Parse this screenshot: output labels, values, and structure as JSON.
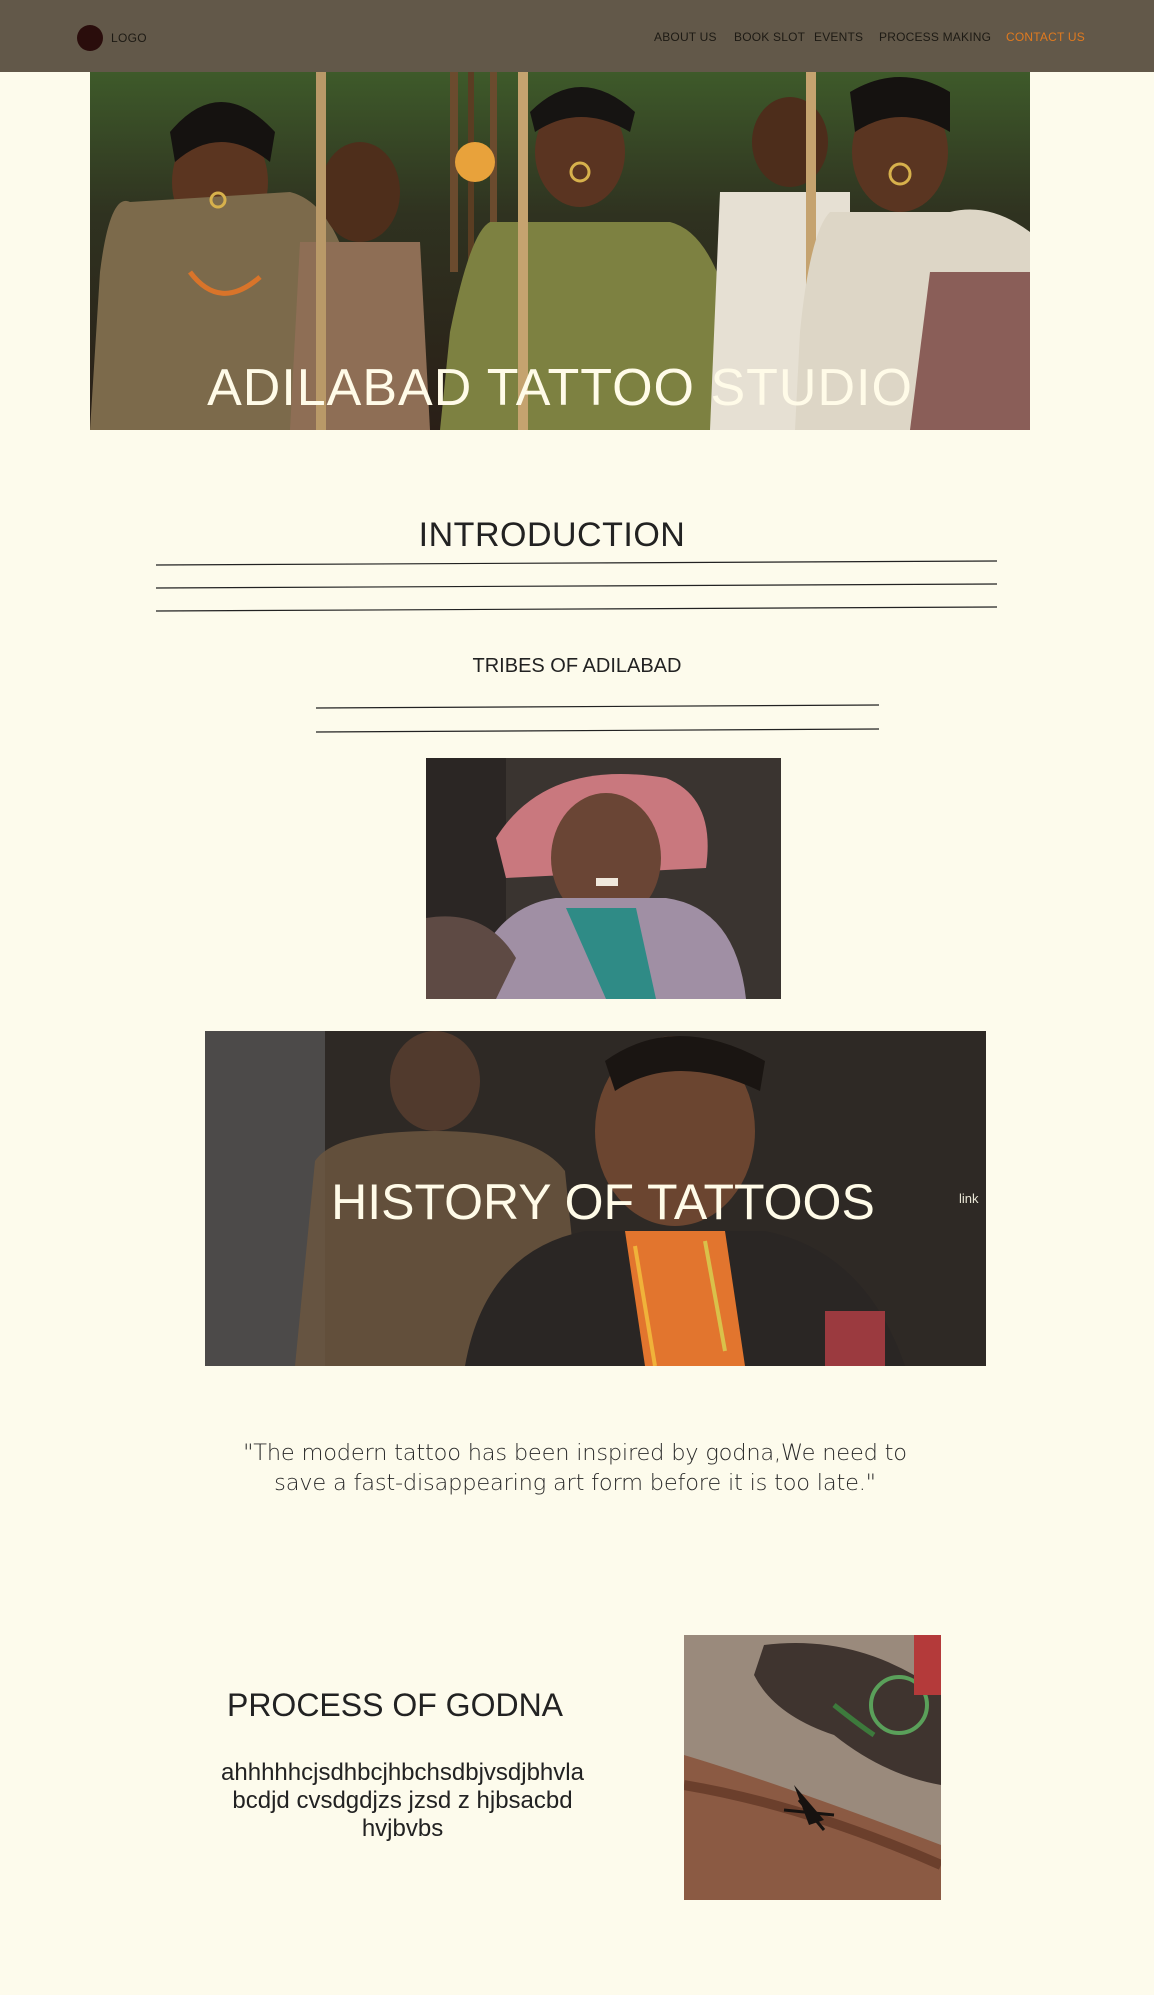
{
  "nav": {
    "logo": "LOGO",
    "links": [
      "ABOUT US",
      "BOOK SLOT",
      "EVENTS",
      "PROCESS MAKING",
      "CONTACT US"
    ],
    "contact_color": "#e07a1f"
  },
  "hero": {
    "title": "ADILABAD TATTOO STUDIO"
  },
  "intro": {
    "title": "INTRODUCTION"
  },
  "tribes": {
    "title": "TRIBES OF ADILABAD"
  },
  "history": {
    "title": "HISTORY OF TATTOOS",
    "link": "link"
  },
  "quote": {
    "text": "\"The modern tattoo has been inspired by godna,We need to save a fast-disappearing art form before it is too late.\""
  },
  "process": {
    "title": "PROCESS OF GODNA",
    "body": "ahhhhhcjsdhbcjhbchsdbjvsdjbhvla bcdjd cvsdgdjzs jzsd z hjbsacbd hvjbvbs"
  },
  "colors": {
    "background": "#fdfbec",
    "navbar": "#625849",
    "accent": "#e07a1f"
  }
}
